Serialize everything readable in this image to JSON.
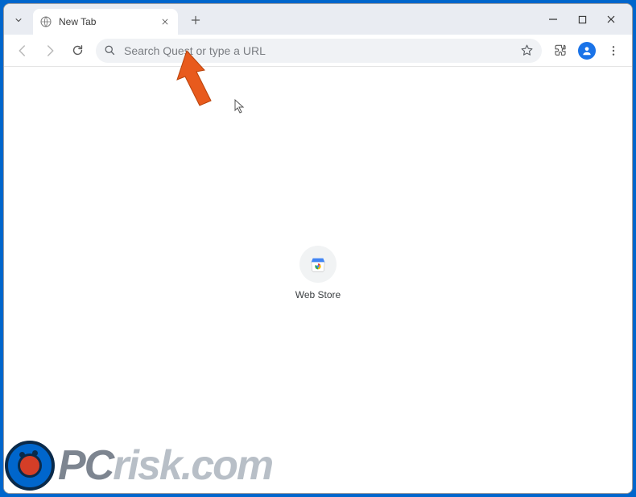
{
  "window": {
    "tab": {
      "title": "New Tab",
      "favicon": "globe-icon"
    }
  },
  "toolbar": {
    "omnibox_placeholder": "Search Quest or type a URL"
  },
  "content": {
    "shortcut": {
      "label": "Web Store",
      "icon": "chrome-store-icon"
    }
  },
  "watermark": {
    "text1": "PC",
    "text2": "risk",
    "text3": ".com"
  }
}
